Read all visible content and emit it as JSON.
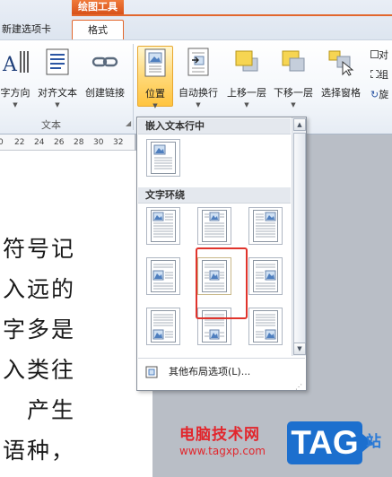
{
  "tabs": {
    "context_title": "绘图工具",
    "new_tab": "新建选项卡",
    "format": "格式"
  },
  "ribbon": {
    "buttons": [
      {
        "label": "字方向",
        "icon": "text-direction-icon"
      },
      {
        "label": "对齐文本",
        "icon": "align-text-icon"
      },
      {
        "label": "创建链接",
        "icon": "chain-link-icon"
      },
      {
        "label": "位置",
        "icon": "position-icon"
      },
      {
        "label": "自动换行",
        "icon": "wrap-text-icon"
      },
      {
        "label": "上移一层",
        "icon": "bring-forward-icon"
      },
      {
        "label": "下移一层",
        "icon": "send-backward-icon"
      },
      {
        "label": "选择窗格",
        "icon": "selection-pane-icon"
      }
    ],
    "group_label": "文本",
    "side_items": [
      "对",
      "组",
      "旋"
    ]
  },
  "ruler": {
    "ticks": [
      "22",
      "24",
      "26",
      "28",
      "30",
      "32"
    ]
  },
  "document": {
    "lines": [
      "符号记",
      "入远的",
      "字多是",
      "入类往",
      "产生",
      "语种，"
    ]
  },
  "position_menu": {
    "section_inline": "嵌入文本行中",
    "section_wrap": "文字环绕",
    "more_options": "其他布局选项(L)...",
    "wrap_options": [
      "top-left",
      "top-center",
      "top-right",
      "middle-left",
      "middle-center",
      "middle-right",
      "bottom-left",
      "bottom-center",
      "bottom-right"
    ]
  },
  "watermark": {
    "text": "电脑技术网",
    "url": "www.tagxp.com",
    "tag": "TAG",
    "side": "站"
  },
  "colors": {
    "accent": "#e2672d",
    "highlight": "#ffd979",
    "callout": "#e0342c",
    "watermark_red": "#e2262c",
    "watermark_blue": "#1c6fce"
  }
}
